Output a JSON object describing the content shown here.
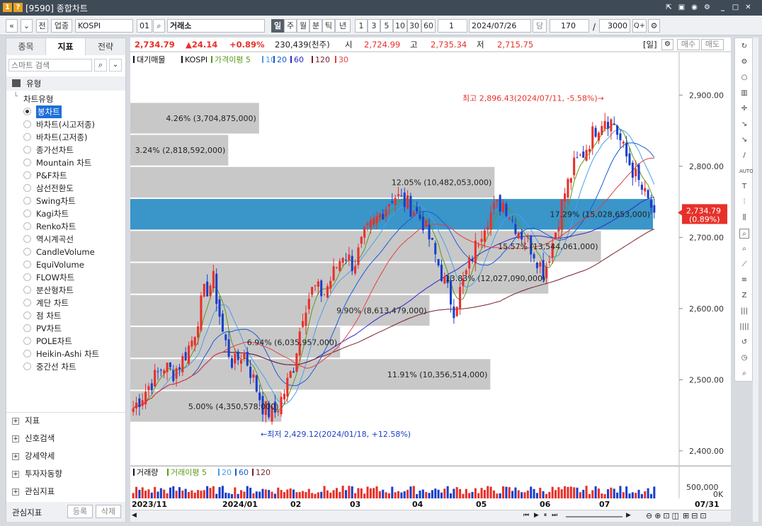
{
  "window": {
    "title": "[9590] 종합차트",
    "badge1": "1",
    "badge2": "?"
  },
  "toolbar": {
    "nav_prev": "«",
    "nav_menu": "»",
    "btn_jeon": "전",
    "btn_upjong": "업종",
    "index_code": "KOSPI",
    "index_num": "01",
    "exchange": "거래소",
    "periods": [
      "일",
      "주",
      "월",
      "분",
      "틱",
      "년"
    ],
    "numbers": [
      "1",
      "3",
      "5",
      "10",
      "30",
      "60"
    ],
    "count_small": "1",
    "date": "2024/07/26",
    "btn_dang": "당",
    "count": "170",
    "slash": "/",
    "total": "3000",
    "zoom": "Q+"
  },
  "left_panel": {
    "tabs": [
      "종목",
      "지표",
      "전략"
    ],
    "active_tab": "지표",
    "search_placeholder": "스마트 검색",
    "group_label": "유형",
    "tree_root": "차트유형",
    "chart_types": [
      "봉차트",
      "바차트(시고저종)",
      "바차트(고저종)",
      "종가선차트",
      "Mountain 차트",
      "P&F차트",
      "삼선전환도",
      "Swing차트",
      "Kagi차트",
      "Renko차트",
      "역시계곡선",
      "CandleVolume",
      "EquiVolume",
      "FLOW차트",
      "분산형차트",
      "계단 차트",
      "점 차트",
      "PV차트",
      "POLE차트",
      "Heikin-Ashi 차트",
      "중간선 차트"
    ],
    "selected_type": "봉차트",
    "sections": [
      "지표",
      "신호검색",
      "강세약세",
      "투자자동향",
      "관심지표"
    ],
    "footer_label": "관심지표",
    "btn_register": "등록",
    "btn_delete": "삭제"
  },
  "infobar": {
    "price": "2,734.79",
    "change": "▲24.14",
    "change_pct": "+0.89%",
    "volume": "230,439(천주)",
    "open_label": "시",
    "open": "2,724.99",
    "high_label": "고",
    "high": "2,735.34",
    "low_label": "저",
    "low": "2,715.75",
    "period_tag": "[일]",
    "buy": "매수",
    "sell": "매도"
  },
  "legend": {
    "title": "대기매물",
    "index": "KOSPI",
    "ma_label": "가격이평 5",
    "ma_periods": [
      "10",
      "20",
      "60",
      "120",
      "30"
    ]
  },
  "colors": {
    "up": "#e8302a",
    "down": "#1a3fc9",
    "ma5": "#5a9a1a",
    "ma10": "#4aa0e8",
    "ma20": "#1a5bd8",
    "ma60": "#2a2ac8",
    "ma120": "#7a1f2a",
    "ma30": "#e84040",
    "band": "#c8c8c8",
    "band_hl": "#3a95c9",
    "accent": "#e8302a"
  },
  "chart_data": {
    "type": "candlestick",
    "x_labels": [
      "2023/11",
      "2024/01",
      "02",
      "03",
      "04",
      "05",
      "06",
      "07"
    ],
    "y_ticks": [
      2400,
      2500,
      2600,
      2700,
      2800,
      2900
    ],
    "y_tick_labels": [
      "2,400.00",
      "2,500.00",
      "2,600.00",
      "2,700.00",
      "2,800.00",
      "2,900.00"
    ],
    "ylim": [
      2380,
      2960
    ],
    "last_price_label": "2,734.79",
    "last_change_label": "(0.89%)",
    "max_annotation": "최고 2,896.43(2024/07/11, -5.58%)→",
    "min_annotation": "←최저 2,429.12(2024/01/18, +12.58%)",
    "volume_profile": [
      {
        "label": "4.26% (3,704,875,000)",
        "pct": 4.26,
        "lo": 2845,
        "hi": 2890
      },
      {
        "label": "3.24% (2,818,592,000)",
        "pct": 3.24,
        "lo": 2800,
        "hi": 2845
      },
      {
        "label": "12.05% (10,482,053,000)",
        "pct": 12.05,
        "lo": 2755,
        "hi": 2800
      },
      {
        "label": "17.29% (15,028,653,000)",
        "pct": 17.29,
        "lo": 2710,
        "hi": 2755,
        "highlight": true
      },
      {
        "label": "15.57% (13,544,061,000)",
        "pct": 15.57,
        "lo": 2665,
        "hi": 2710
      },
      {
        "label": "13.83% (12,027,090,000)",
        "pct": 13.83,
        "lo": 2620,
        "hi": 2665
      },
      {
        "label": "9.90% (8,613,479,000)",
        "pct": 9.9,
        "lo": 2575,
        "hi": 2620
      },
      {
        "label": "6.94% (6,035,957,000)",
        "pct": 6.94,
        "lo": 2530,
        "hi": 2575
      },
      {
        "label": "11.91% (10,356,514,000)",
        "pct": 11.91,
        "lo": 2485,
        "hi": 2530
      },
      {
        "label": "5.00% (4,350,578,000)",
        "pct": 5.0,
        "lo": 2440,
        "hi": 2485
      }
    ],
    "anchors": [
      2460,
      2480,
      2500,
      2520,
      2510,
      2530,
      2560,
      2620,
      2640,
      2560,
      2520,
      2540,
      2500,
      2460,
      2450,
      2480,
      2520,
      2600,
      2630,
      2620,
      2650,
      2680,
      2660,
      2700,
      2720,
      2740,
      2760,
      2750,
      2740,
      2720,
      2680,
      2640,
      2600,
      2640,
      2680,
      2720,
      2740,
      2750,
      2720,
      2700,
      2680,
      2650,
      2700,
      2760,
      2800,
      2820,
      2850,
      2870,
      2860,
      2820,
      2790,
      2760,
      2735
    ],
    "volume_label": "거래량",
    "volume_ma_label": "거래이평 5",
    "volume_ma_periods": [
      "20",
      "60",
      "120"
    ],
    "volume_ticks": [
      "500,000",
      "0K"
    ],
    "last_date": "07/31"
  }
}
